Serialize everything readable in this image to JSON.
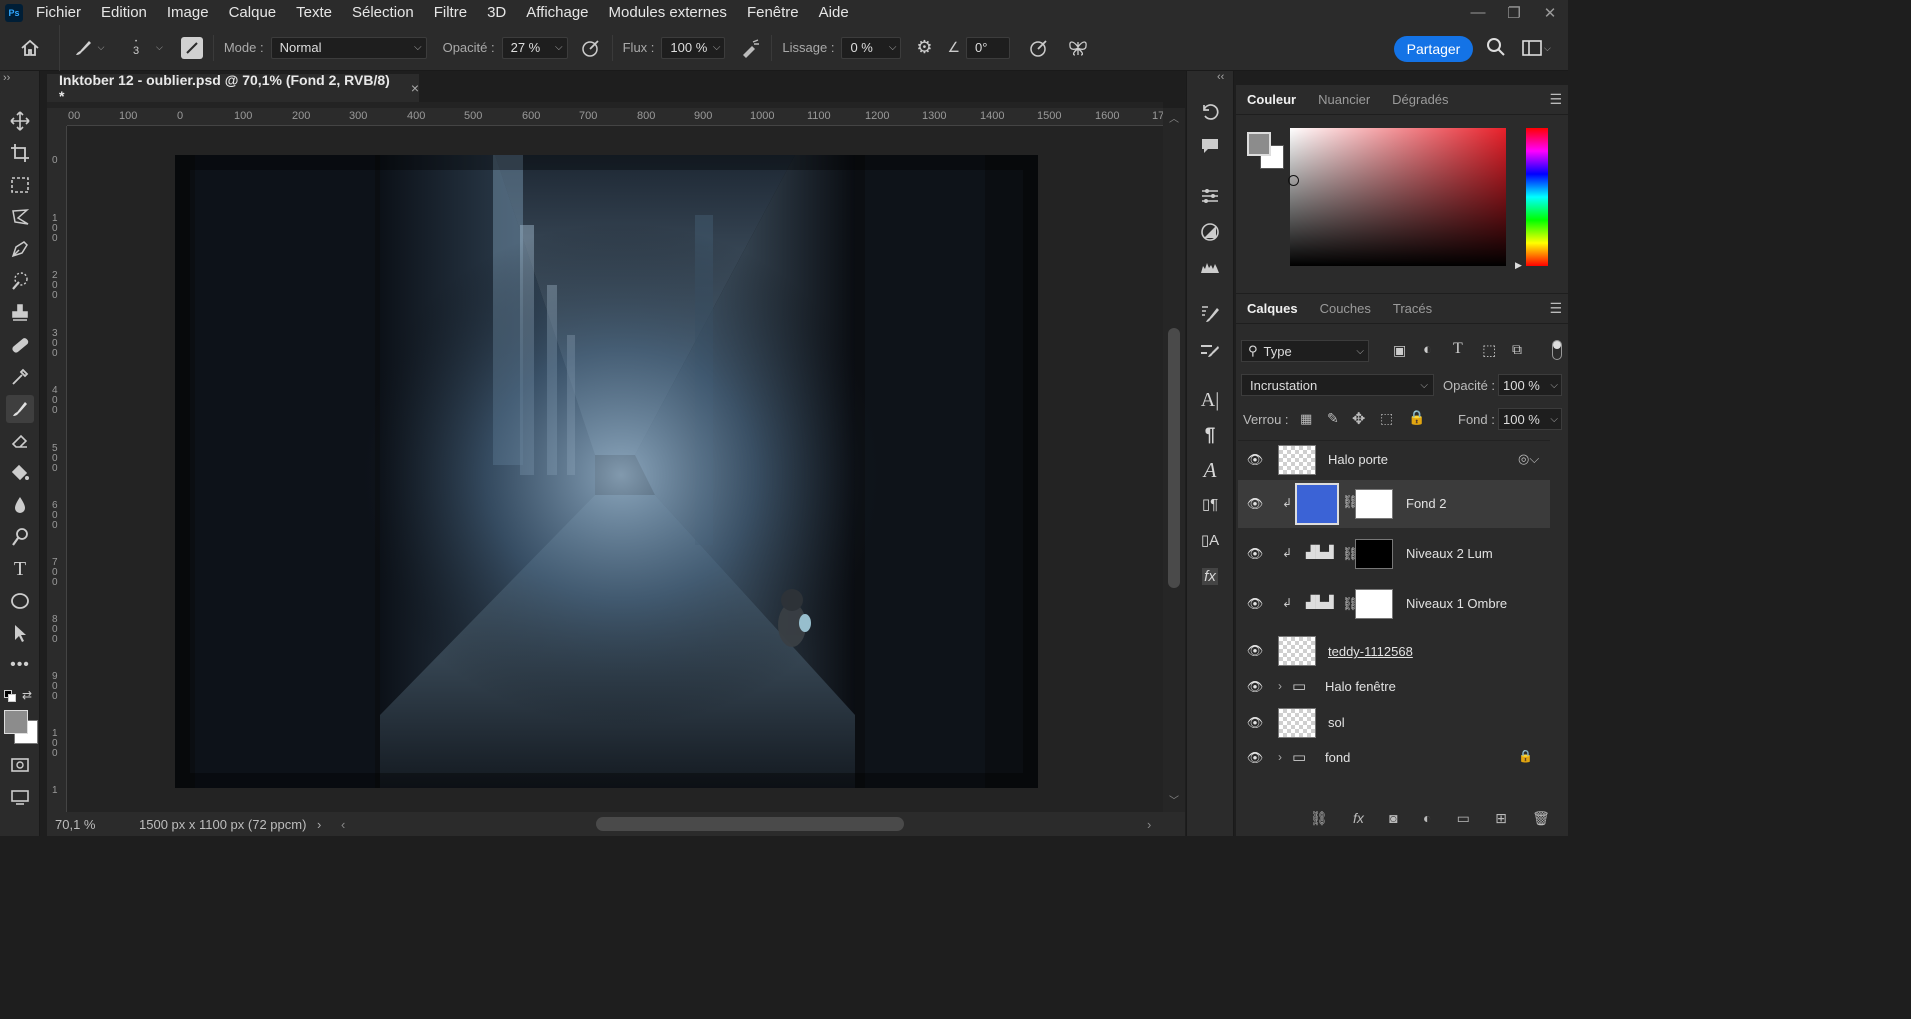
{
  "app": {
    "logo": "Ps"
  },
  "menu": [
    "Fichier",
    "Edition",
    "Image",
    "Calque",
    "Texte",
    "Sélection",
    "Filtre",
    "3D",
    "Affichage",
    "Modules externes",
    "Fenêtre",
    "Aide"
  ],
  "window_controls": {
    "minimize": "—",
    "restore": "❐",
    "close": "✕"
  },
  "options": {
    "brush_size": "3",
    "mode_label": "Mode :",
    "mode_value": "Normal",
    "opacity_label": "Opacité :",
    "opacity_value": "27 %",
    "flow_label": "Flux :",
    "flow_value": "100 %",
    "smoothing_label": "Lissage :",
    "smoothing_value": "0 %",
    "angle_value": "0°",
    "share_label": "Partager"
  },
  "document": {
    "tab_title": "Inktober 12 - oublier.psd @ 70,1% (Fond 2, RVB/8) *",
    "tab_close": "×",
    "zoom": "70,1 %",
    "dimensions": "1500 px x 1100 px (72 ppcm)",
    "ruler_h_labels": [
      "00",
      "100",
      "0",
      "100",
      "200",
      "300",
      "400",
      "500",
      "600",
      "700",
      "800",
      "900",
      "1000",
      "1100",
      "1200",
      "1300",
      "1400",
      "1500",
      "1600",
      "17"
    ],
    "ruler_v_labels": [
      "0",
      "100",
      "200",
      "300",
      "400",
      "500",
      "600",
      "700",
      "800",
      "900",
      "100",
      "1"
    ]
  },
  "color_panel": {
    "tabs": [
      "Couleur",
      "Nuancier",
      "Dégradés"
    ],
    "foreground": "#8c8c8c",
    "background": "#ffffff"
  },
  "layers_panel": {
    "tabs": [
      "Calques",
      "Couches",
      "Tracés"
    ],
    "filter_label": "Type",
    "blend_mode": "Incrustation",
    "opacity_label": "Opacité :",
    "opacity_value": "100 %",
    "lock_label": "Verrou :",
    "fill_label": "Fond :",
    "fill_value": "100 %",
    "layers": [
      {
        "name": "Halo porte",
        "type": "smart"
      },
      {
        "name": "Fond 2",
        "type": "fill",
        "selected": true
      },
      {
        "name": "Niveaux 2 Lum",
        "type": "adjustment"
      },
      {
        "name": "Niveaux 1 Ombre",
        "type": "adjustment"
      },
      {
        "name": "teddy-1112568",
        "type": "smart"
      },
      {
        "name": "Halo fenêtre",
        "type": "group"
      },
      {
        "name": "sol",
        "type": "pixel"
      },
      {
        "name": "fond",
        "type": "group",
        "locked": true
      }
    ]
  },
  "colors": {
    "accent": "#1473e6",
    "fill_layer": "#3b63d6"
  }
}
